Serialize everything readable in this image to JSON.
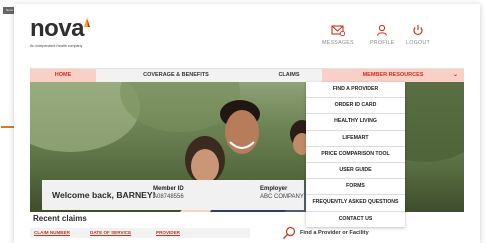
{
  "corner_tag": "Nova Note",
  "brand": {
    "name": "nova",
    "tagline": "An Independent Health company",
    "accent_color": "#c9341f",
    "mark_color": "#f5a623"
  },
  "top_actions": [
    {
      "label": "MESSAGES",
      "icon": "envelope-icon"
    },
    {
      "label": "PROFILE",
      "icon": "person-icon"
    },
    {
      "label": "LOGOUT",
      "icon": "power-icon"
    }
  ],
  "nav": {
    "home": "HOME",
    "coverage": "COVERAGE & BENEFITS",
    "claims": "CLAIMS",
    "resources": "MEMBER RESOURCES",
    "resources_icon": "chevron-down-icon"
  },
  "member_resources_menu": [
    "FIND A PROVIDER",
    "ORDER ID CARD",
    "HEALTHY LIVING",
    "LIFEMART",
    "PRICE COMPARISON TOOL",
    "USER GUIDE",
    "FORMS",
    "FREQUENTLY ASKED QUESTIONS",
    "CONTACT US"
  ],
  "welcome": {
    "greeting": "Welcome back, BARNEY!",
    "member_id_label": "Member ID",
    "member_id_value": "A08748556",
    "employer_label": "Employer",
    "employer_value": "ABC COMPANY"
  },
  "recent_claims": {
    "title": "Recent claims",
    "columns": [
      "CLAIM NUMBER",
      "DATE OF SERVICE",
      "PROVIDER"
    ]
  },
  "find_provider": {
    "label": "Find a Provider or Facility",
    "icon": "search-icon"
  }
}
